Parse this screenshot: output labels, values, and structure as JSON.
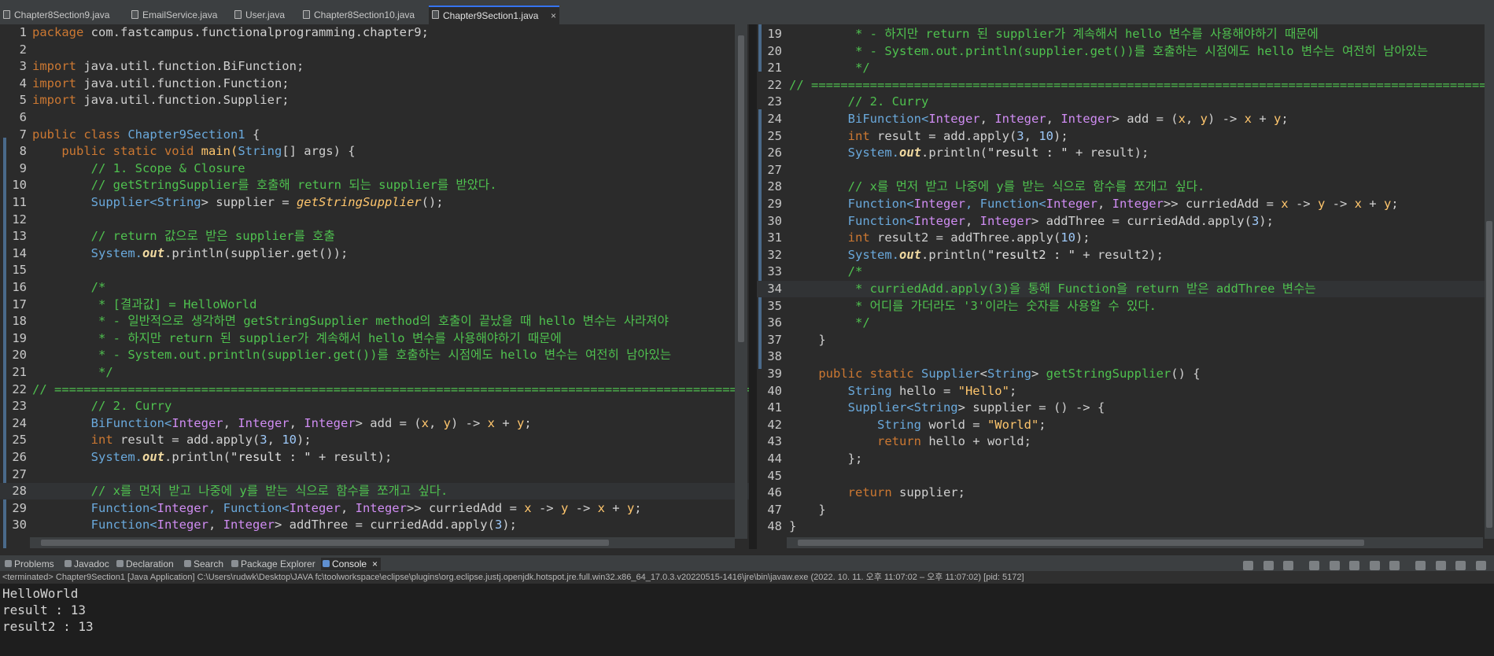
{
  "tabs": [
    "Chapter8Section9.java",
    "EmailService.java",
    "User.java",
    "Chapter8Section10.java",
    "Chapter9Section1.java"
  ],
  "active_tab_index": 4,
  "left_editor": {
    "line_numbers": [
      "1",
      "2",
      "3",
      "4",
      "5",
      "6",
      "7",
      "8",
      "9",
      "10",
      "11",
      "12",
      "13",
      "14",
      "15",
      "16",
      "17",
      "18",
      "19",
      "20",
      "21",
      "22",
      "23",
      "24",
      "25",
      "26",
      "27",
      "28",
      "29",
      "30"
    ]
  },
  "right_editor": {
    "line_numbers": [
      "19",
      "20",
      "21",
      "22",
      "23",
      "24",
      "25",
      "26",
      "27",
      "28",
      "29",
      "30",
      "31",
      "32",
      "33",
      "34",
      "35",
      "36",
      "37",
      "38",
      "39",
      "40",
      "41",
      "42",
      "43",
      "44",
      "45",
      "46",
      "47",
      "48"
    ]
  },
  "code": {
    "l1a": "package",
    "l1b": " com.fastcampus.functionalprogramming.chapter9;",
    "l3a": "import",
    "l3b": " java.util.function.BiFunction;",
    "l4a": "import",
    "l4b": " java.util.function.Function;",
    "l5a": "import",
    "l5b": " java.util.function.Supplier;",
    "l7a": "public class ",
    "l7b": "Chapter9Section1",
    " l7c": " {",
    "l7c": " {",
    "l8a": "    public static void ",
    "l8b": "main(",
    "l8c": "String",
    "l8d": "[] args) {",
    "c9": "        // 1. Scope & Closure",
    "c10": "        // getStringSupplier를 호출해 return 되는 supplier를 받았다.",
    "l11a": "        Supplier<",
    "l11b": "String",
    "l11c": "> supplier = ",
    "l11d": "getStringSupplier",
    "l11e": "();",
    "c13": "        // return 값으로 받은 supplier를 호출",
    "l14a": "        System.",
    "l14b": "out",
    "l14c": ".println(supplier.get());",
    "c16": "        /*",
    "c17": "         * [결과값] = HelloWorld",
    "c18": "         * - 일반적으로 생각하면 getStringSupplier method의 호출이 끝났을 때 hello 변수는 사라져야",
    "c19": "         * - 하지만 return 된 supplier가 계속해서 hello 변수를 사용해야하기 때문에",
    "c20": "         * - System.out.println(supplier.get())를 호출하는 시점에도 hello 변수는 여전히 남아있는",
    "c21": "         */",
    "c22": "// ==========================================================================================================",
    "c23": "        // 2. Curry",
    "l24a": "        BiFunction<",
    "l24b": "Integer",
    ", l24c": ", ",
    "l24c": ", ",
    "l24d": "> add = (",
    "l24e": "x",
    ", l24f": ", ",
    "l24f": ", ",
    "l24g": "y",
    "l24h": ") -> ",
    "l24i": "x",
    " l24j": " + ",
    "l24j": " + ",
    "l24k": "y",
    "l24l": ";",
    "l25a": "        int ",
    "l25b": "result = add.apply(",
    "l25c": "3",
    ", l25d": ", ",
    "l25d": ", ",
    "l25e": "10",
    "l25f": ");",
    "l26a": "        System.",
    "l26b": "out",
    "l26c": ".println(",
    "l26d": "\"result : \"",
    "l26e": " + result);",
    "c28": "        // x를 먼저 받고 나중에 y를 받는 식으로 함수를 쪼개고 싶다.",
    "l29a": "        Function<",
    "l29b": "Integer",
    ", l29c": ", ",
    "l29c": ", Function<",
    "l29d": "Integer",
    "l29e": ", ",
    "l29f": "Integer",
    "l29g": ">> curriedAdd = ",
    "l29h": "x",
    "l29i": " -> ",
    "l29j": "y",
    "l29k": " -> ",
    "l29l": "x",
    "l29m": " + ",
    "l29n": "y",
    "l29o": ";",
    "l30a": "        Function<",
    "l30b": "Integer",
    "l30c": ", ",
    "l30d": "Integer",
    "l30e": "> addThree = curriedAdd.apply(",
    "l30f": "3",
    "l30g": ");",
    "l31a": "        int ",
    "l31b": "result2 = addThree.apply(",
    "l31c": "10",
    "l31d": ");",
    "l32a": "        System.",
    "l32b": "out",
    "l32c": ".println(",
    "l32d": "\"result2 : \"",
    "l32e": " + result2);",
    "c33": "        /*",
    "c34": "         * curriedAdd.apply(3)을 통해 Function을 return 받은 addThree 변수는",
    "c35": "         * 어디를 가더라도 '3'이라는 숫자를 사용할 수 있다.",
    "c36": "         */",
    "c37": "    }",
    "l39a": "    public static ",
    "l39b": "Supplier",
    "l39c": "<",
    "l39d": "String",
    "l39e": "> ",
    "l39f": "getStringSupplier",
    "l39g": "() {",
    "l40a": "        String ",
    "l40b": "hello = ",
    "l40c": "\"Hello\"",
    "l40d": ";",
    "l41a": "        Supplier<",
    "l41b": "String",
    "l41c": "> supplier = () -> {",
    "l42a": "            String ",
    "l42b": "world = ",
    "l42c": "\"World\"",
    "l42d": ";",
    "l43a": "            return ",
    "l43b": "hello + world;",
    "c44": "        };",
    "l46a": "        return ",
    "l46b": "supplier;",
    "c47": "    }",
    "c48": "}",
    "int_kw": "Integer"
  },
  "console_tabs": [
    "Problems",
    "Javadoc",
    "Declaration",
    "Search",
    "Package Explorer",
    "Console"
  ],
  "status_text": "<terminated> Chapter9Section1 [Java Application] C:\\Users\\rudwk\\Desktop\\JAVA fc\\toolworkspace\\eclipse\\plugins\\org.eclipse.justj.openjdk.hotspot.jre.full.win32.x86_64_17.0.3.v20220515-1416\\jre\\bin\\javaw.exe  (2022. 10. 11. 오후 11:07:02 – 오후 11:07:02) [pid: 5172]",
  "console_output": [
    "HelloWorld",
    "result : 13",
    "result2 : 13"
  ]
}
